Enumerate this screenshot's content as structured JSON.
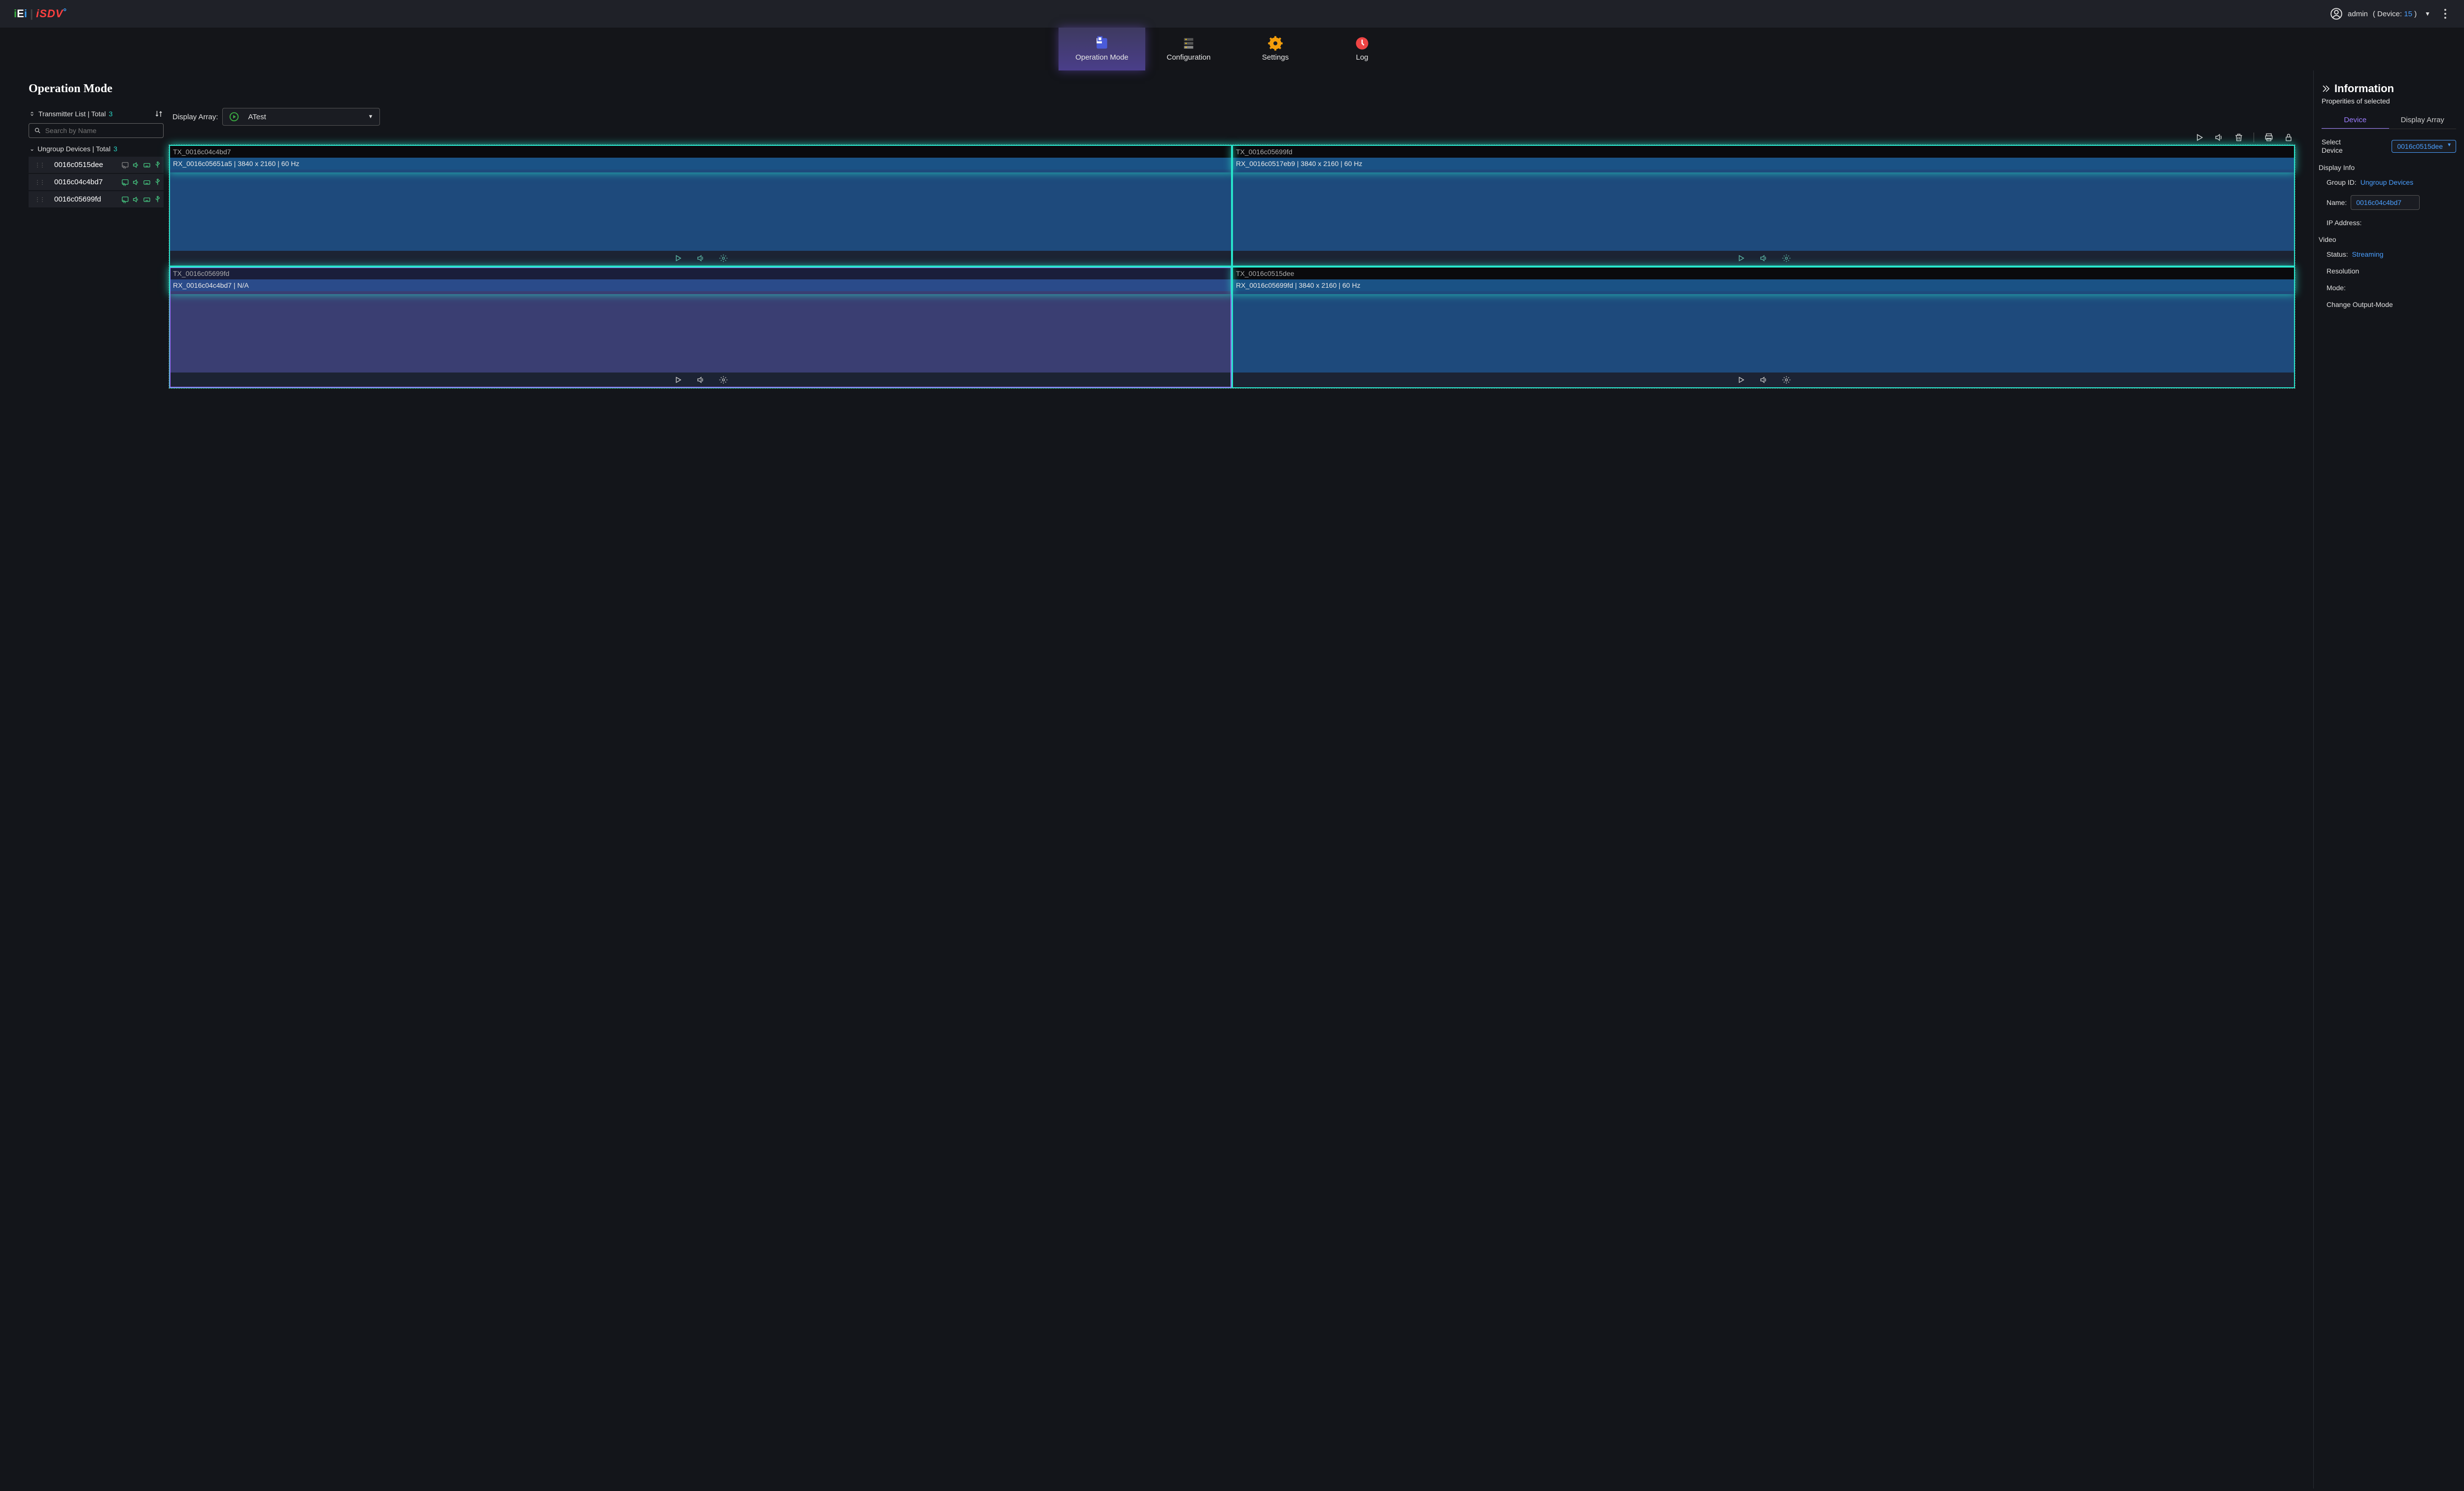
{
  "header": {
    "user": "admin",
    "device_label": "Device:",
    "device_count": "15"
  },
  "nav": {
    "operation_mode": "Operation Mode",
    "configuration": "Configuration",
    "settings": "Settings",
    "log": "Log"
  },
  "page_title": "Operation Mode",
  "left": {
    "transmitter_label": "Transmitter List | Total",
    "transmitter_count": "3",
    "search_placeholder": "Search by Name",
    "ungroup_label": "Ungroup Devices | Total",
    "ungroup_count": "3",
    "devices": [
      {
        "name": "0016c0515dee",
        "cast": false
      },
      {
        "name": "0016c04c4bd7",
        "cast": true
      },
      {
        "name": "0016c05699fd",
        "cast": true
      }
    ]
  },
  "center": {
    "display_array_label": "Display Array:",
    "selected_array": "ATest",
    "tiles": [
      {
        "tx": "TX_0016c04c4bd7",
        "rx": "RX_0016c05651a5 | 3840 x 2160 | 60 Hz"
      },
      {
        "tx": "TX_0016c05699fd",
        "rx": "RX_0016c0517eb9 | 3840 x 2160 | 60 Hz"
      },
      {
        "tx": "TX_0016c05699fd",
        "rx": "RX_0016c04c4bd7 | N/A"
      },
      {
        "tx": "TX_0016c0515dee",
        "rx": "RX_0016c05699fd | 3840 x 2160 | 60 Hz"
      }
    ]
  },
  "info": {
    "title": "Information",
    "subtitle": "Properities of selected",
    "tab_device": "Device",
    "tab_array": "Display Array",
    "select_device_label": "Select Device",
    "select_device_value": "0016c0515dee",
    "display_info_label": "Display Info",
    "group_id_label": "Group ID:",
    "group_id_value": "Ungroup Devices",
    "name_label": "Name:",
    "name_value": "0016c04c4bd7",
    "ip_label": "IP Address:",
    "video_label": "Video",
    "status_label": "Status:",
    "status_value": "Streaming",
    "resolution_label": "Resolution",
    "mode_label": "Mode:",
    "change_mode_label": "Change Output-Mode"
  }
}
